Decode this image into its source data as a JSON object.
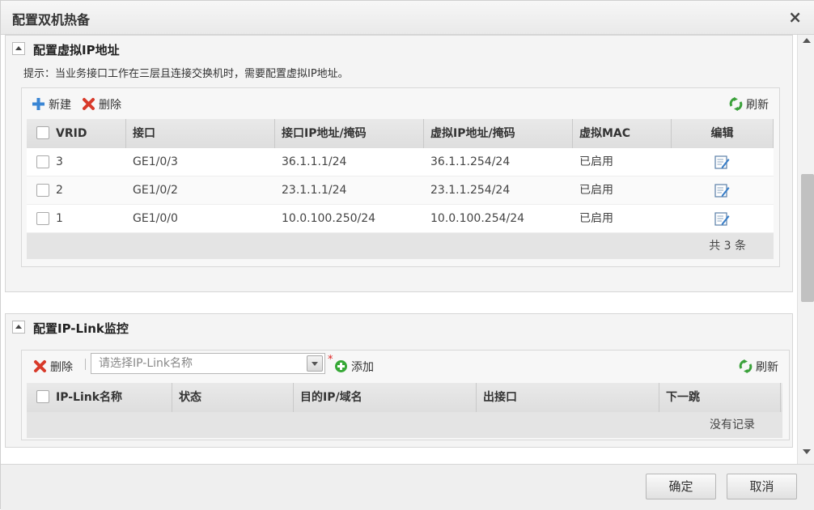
{
  "dialog": {
    "title": "配置双机热备",
    "close_glyph": "×"
  },
  "vip_section": {
    "title": "配置虚拟IP地址",
    "hint": "提示：当业务接口工作在三层且连接交换机时，需要配置虚拟IP地址。",
    "toolbar": {
      "new_label": "新建",
      "delete_label": "删除",
      "refresh_label": "刷新"
    },
    "columns": [
      "VRID",
      "接口",
      "接口IP地址/掩码",
      "虚拟IP地址/掩码",
      "虚拟MAC",
      "编辑"
    ],
    "rows": [
      {
        "vrid": "3",
        "iface": "GE1/0/3",
        "ip": "36.1.1.1/24",
        "vip": "36.1.1.254/24",
        "mac": "已启用"
      },
      {
        "vrid": "2",
        "iface": "GE1/0/2",
        "ip": "23.1.1.1/24",
        "vip": "23.1.1.254/24",
        "mac": "已启用"
      },
      {
        "vrid": "1",
        "iface": "GE1/0/0",
        "ip": "10.0.100.250/24",
        "vip": "10.0.100.254/24",
        "mac": "已启用"
      }
    ],
    "footer_count": "共 3 条"
  },
  "iplink_section": {
    "title": "配置IP-Link监控",
    "toolbar": {
      "delete_label": "删除",
      "select_placeholder": "请选择IP-Link名称",
      "required_mark": "*",
      "add_label": "添加",
      "refresh_label": "刷新"
    },
    "columns": [
      "IP-Link名称",
      "状态",
      "目的IP/域名",
      "出接口",
      "下一跳"
    ],
    "empty_text": "没有记录"
  },
  "buttons": {
    "ok": "确定",
    "cancel": "取消"
  },
  "icons": {
    "close": "close-icon",
    "collapse": "collapse-arrow-icon",
    "new": "plus-icon",
    "delete": "red-x-icon",
    "refresh": "refresh-icon",
    "edit": "edit-icon",
    "add": "green-plus-circle-icon"
  },
  "colors": {
    "plus_blue": "#3a86d4",
    "delete_red": "#d83a2a",
    "refresh_green": "#3aa13a",
    "add_green": "#36a836"
  }
}
